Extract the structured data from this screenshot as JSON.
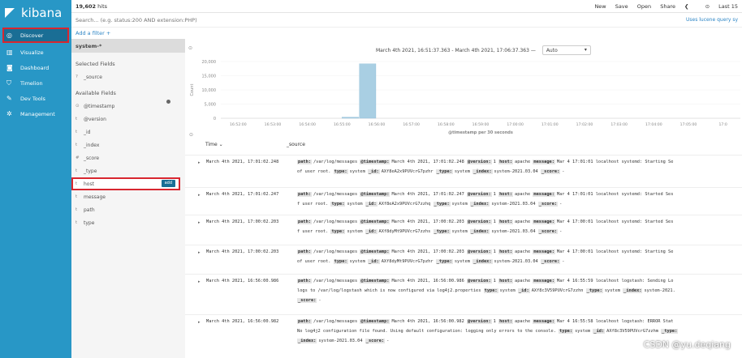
{
  "app": {
    "brand": "kibana"
  },
  "sidebar": {
    "items": [
      {
        "label": "Discover",
        "icon": "compass-icon"
      },
      {
        "label": "Visualize",
        "icon": "bar-chart-icon"
      },
      {
        "label": "Dashboard",
        "icon": "dashboard-icon"
      },
      {
        "label": "Timelion",
        "icon": "shield-icon"
      },
      {
        "label": "Dev Tools",
        "icon": "wrench-icon"
      },
      {
        "label": "Management",
        "icon": "gear-icon"
      }
    ]
  },
  "topbar": {
    "hits_count": "19,602",
    "hits_label": "hits",
    "menu": [
      "New",
      "Save",
      "Open",
      "Share"
    ],
    "range_label": "Last 15"
  },
  "search": {
    "placeholder": "Search... (e.g. status:200 AND extension:PHP)",
    "lucene_link": "Uses lucene query sy"
  },
  "filter": {
    "add_label": "Add a filter +"
  },
  "field_panel": {
    "index_pattern": "system-*",
    "selected_heading": "Selected Fields",
    "selected_fields": [
      {
        "type": "?",
        "name": "_source"
      }
    ],
    "available_heading": "Available Fields",
    "available_fields": [
      {
        "type": "⊙",
        "name": "@timestamp"
      },
      {
        "type": "t",
        "name": "@version"
      },
      {
        "type": "t",
        "name": "_id"
      },
      {
        "type": "t",
        "name": "_index"
      },
      {
        "type": "#",
        "name": "_score"
      },
      {
        "type": "t",
        "name": "_type"
      },
      {
        "type": "t",
        "name": "host"
      },
      {
        "type": "t",
        "name": "message"
      },
      {
        "type": "t",
        "name": "path"
      },
      {
        "type": "t",
        "name": "type"
      }
    ],
    "add_button": "add"
  },
  "histogram": {
    "time_range": "March 4th 2021, 16:51:37.363 - March 4th 2021, 17:06:37.363 —",
    "interval": "Auto",
    "y_label": "Count",
    "x_caption": "@timestamp per 30 seconds"
  },
  "chart_data": {
    "type": "bar",
    "ylabel": "Count",
    "xlabel": "@timestamp per 30 seconds",
    "ylim": [
      0,
      20000
    ],
    "y_ticks": [
      "20,000",
      "15,000",
      "10,000",
      "5,000",
      "0"
    ],
    "x_ticks": [
      "16:52:00",
      "16:53:00",
      "16:54:00",
      "16:55:00",
      "16:56:00",
      "16:57:00",
      "16:58:00",
      "16:59:00",
      "17:00:00",
      "17:01:00",
      "17:02:00",
      "17:03:00",
      "17:04:00",
      "17:05:00",
      "17:0"
    ],
    "series": [
      {
        "values": [
          {
            "x": "16:55:00",
            "y": 400
          },
          {
            "x": "16:55:30",
            "y": 19200
          }
        ]
      }
    ]
  },
  "table": {
    "headers": [
      "Time",
      "_source"
    ],
    "rows": [
      {
        "time": "March 4th 2021, 17:01:02.248",
        "source": [
          [
            "path:",
            "/var/log/messages"
          ],
          [
            "@timestamp:",
            "March 4th 2021, 17:01:02.248"
          ],
          [
            "@version:",
            "1"
          ],
          [
            "host:",
            "apache"
          ],
          [
            "message:",
            "Mar 4 17:01:01 localhost systemd: Starting Se"
          ]
        ],
        "source2": [
          [
            "",
            "of user root."
          ],
          [
            "type:",
            "system"
          ],
          [
            "_id:",
            "AXf8eA2x9PUVcrG7pzhr"
          ],
          [
            "_type:",
            "system"
          ],
          [
            "_index:",
            "system-2021.03.04"
          ],
          [
            "_score:",
            "-"
          ]
        ]
      },
      {
        "time": "March 4th 2021, 17:01:02.247",
        "source": [
          [
            "path:",
            "/var/log/messages"
          ],
          [
            "@timestamp:",
            "March 4th 2021, 17:01:02.247"
          ],
          [
            "@version:",
            "1"
          ],
          [
            "host:",
            "apache"
          ],
          [
            "message:",
            "Mar 4 17:01:01 localhost systemd: Started Ses"
          ]
        ],
        "source2": [
          [
            "",
            "f user root."
          ],
          [
            "type:",
            "system"
          ],
          [
            "_id:",
            "AXf8eA2x9PUVcrG7zzhq"
          ],
          [
            "_type:",
            "system"
          ],
          [
            "_index:",
            "system-2021.03.04"
          ],
          [
            "_score:",
            "-"
          ]
        ]
      },
      {
        "time": "March 4th 2021, 17:00:02.203",
        "source": [
          [
            "path:",
            "/var/log/messages"
          ],
          [
            "@timestamp:",
            "March 4th 2021, 17:00:02.203"
          ],
          [
            "@version:",
            "1"
          ],
          [
            "host:",
            "apache"
          ],
          [
            "message:",
            "Mar 4 17:00:01 localhost systemd: Started Ses"
          ]
        ],
        "source2": [
          [
            "",
            "f user root."
          ],
          [
            "type:",
            "system"
          ],
          [
            "_id:",
            "AXf8dyMt9PUVcrG7zzhs"
          ],
          [
            "_type:",
            "system"
          ],
          [
            "_index:",
            "system-2021.03.04"
          ],
          [
            "_score:",
            "-"
          ]
        ]
      },
      {
        "time": "March 4th 2021, 17:00:02.203",
        "source": [
          [
            "path:",
            "/var/log/messages"
          ],
          [
            "@timestamp:",
            "March 4th 2021, 17:00:02.203"
          ],
          [
            "@version:",
            "1"
          ],
          [
            "host:",
            "apache"
          ],
          [
            "message:",
            "Mar 4 17:00:01 localhost systemd: Starting Se"
          ]
        ],
        "source2": [
          [
            "",
            "of user root."
          ],
          [
            "type:",
            "system"
          ],
          [
            "_id:",
            "AXf8dyMt9PUVcrG7pzhr"
          ],
          [
            "_type:",
            "system"
          ],
          [
            "_index:",
            "system-2021.03.04"
          ],
          [
            "_score:",
            "-"
          ]
        ]
      },
      {
        "time": "March 4th 2021, 16:56:00.986",
        "source": [
          [
            "path:",
            "/var/log/messages"
          ],
          [
            "@timestamp:",
            "March 4th 2021, 16:56:00.986"
          ],
          [
            "@version:",
            "1"
          ],
          [
            "host:",
            "apache"
          ],
          [
            "message:",
            "Mar 4 16:55:59 localhost logstash: Sending Lo"
          ]
        ],
        "source2": [
          [
            "",
            "logs to /var/log/logstash which is now configured via log4j2.properties"
          ],
          [
            "type:",
            "system"
          ],
          [
            "_id:",
            "AXf8c3V59PUVcrG7zzhn"
          ],
          [
            "_type:",
            "system"
          ],
          [
            "_index:",
            "system-2021."
          ]
        ],
        "source3": [
          [
            "_score:",
            "-"
          ]
        ]
      },
      {
        "time": "March 4th 2021, 16:56:00.982",
        "source": [
          [
            "path:",
            "/var/log/messages"
          ],
          [
            "@timestamp:",
            "March 4th 2021, 16:56:00.982"
          ],
          [
            "@version:",
            "1"
          ],
          [
            "host:",
            "apache"
          ],
          [
            "message:",
            "Mar 4 16:55:58 localhost logstash: ERROR Stat"
          ]
        ],
        "source2": [
          [
            "",
            "No log4j2 configuration file found. Using default configuration: logging only errors to the console."
          ],
          [
            "type:",
            "system"
          ],
          [
            "_id:",
            "AXf8c3V59PUVcrG7zzhm"
          ],
          [
            "_type:",
            ""
          ]
        ],
        "source3": [
          [
            "_index:",
            "system-2021.03.04"
          ],
          [
            "_score:",
            "-"
          ]
        ]
      }
    ]
  },
  "watermark": "CSDN @yu.deqiang"
}
